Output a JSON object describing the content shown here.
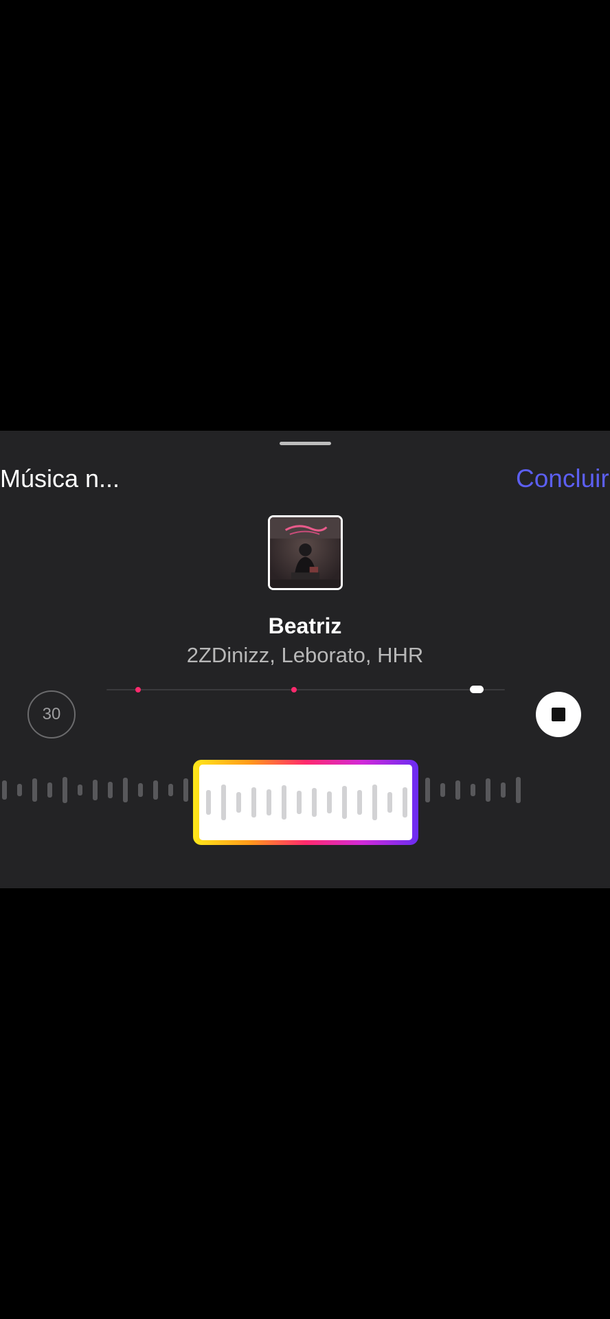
{
  "sheet": {
    "title": "Música n...",
    "done_label": "Concluir"
  },
  "song": {
    "title": "Beatriz",
    "artists": "2ZDinizz, Leborato, HHR"
  },
  "controls": {
    "duration_label": "30",
    "playhead_fraction": 0.93,
    "markers_fraction": [
      0.08,
      0.47
    ]
  },
  "colors": {
    "accent": "#5c5ff2",
    "marker": "#ff2a6d",
    "sheet_bg": "#232325",
    "selector_gradient": [
      "#ffe81a",
      "#ff9a1a",
      "#ff2a6d",
      "#d12ad8",
      "#6a2cf2"
    ]
  },
  "icons": {
    "stop": "stop-icon",
    "grabber": "drag-handle-icon"
  }
}
